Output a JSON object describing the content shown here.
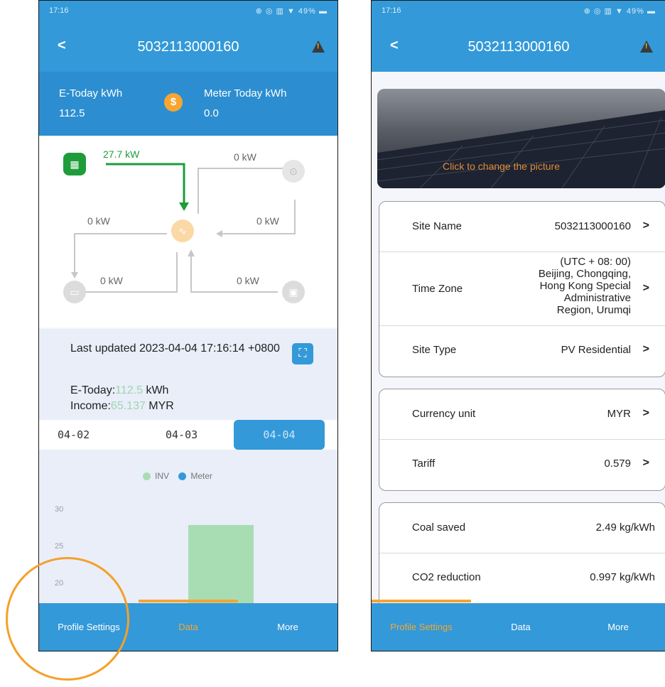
{
  "left": {
    "status_time": "17:16",
    "status_icons": "⊕ ◎ ▥ ▼ 49% ▬",
    "title": "5032113000160",
    "back": "<",
    "energy": {
      "e_today_label": "E-Today kWh",
      "e_today_value": "112.5",
      "meter_label": "Meter Today kWh",
      "meter_value": "0.0",
      "coin": "$"
    },
    "flow": {
      "pv_power": "27.7 kW",
      "grid_power_top": "0 kW",
      "left_power": "0 kW",
      "right_power": "0 kW",
      "battery_power": "0 kW",
      "load_power": "0 kW"
    },
    "card": {
      "updated": "Last updated 2023-04-04 17:16:14 +0800",
      "e_today_label": "E-Today:",
      "e_today_value": "112.5",
      "e_today_unit": " kWh",
      "income_label": "Income:",
      "income_value": "65.137",
      "income_unit": " MYR",
      "dates": [
        "04-02",
        "04-03",
        "04-04"
      ],
      "legend_inv": "INV",
      "legend_meter": "Meter",
      "yticks": [
        "30",
        "25",
        "20"
      ]
    },
    "tabs": [
      "Profile Settings",
      "Data",
      "More"
    ]
  },
  "right": {
    "status_time": "17:16",
    "status_icons": "⊕ ◎ ▥ ▼ 49% ▬",
    "title": "5032113000160",
    "back": "<",
    "hero_text": "Click to change the picture",
    "rows1": [
      {
        "label": "Site Name",
        "value": "5032113000160"
      },
      {
        "label": "Time Zone",
        "value": "(UTC + 08: 00) Beijing, Chongqing, Hong Kong Special Administrative Region, Urumqi"
      },
      {
        "label": "Site Type",
        "value": "PV Residential"
      }
    ],
    "tz_lines": [
      "(UTC + 08: 00)",
      "Beijing, Chongqing,",
      "Hong Kong Special",
      "Administrative",
      "Region, Urumqi"
    ],
    "rows2": [
      {
        "label": "Currency unit",
        "value": "MYR"
      },
      {
        "label": "Tariff",
        "value": "0.579"
      }
    ],
    "rows3": [
      {
        "label": "Coal saved",
        "value": "2.49 kg/kWh"
      },
      {
        "label": "CO2 reduction",
        "value": "0.997 kg/kWh"
      }
    ],
    "chevron": ">",
    "tabs": [
      "Profile Settings",
      "Data",
      "More"
    ]
  },
  "chart_data": {
    "type": "bar",
    "series": [
      {
        "name": "INV",
        "color": "#a8ddb3"
      },
      {
        "name": "Meter",
        "color": "#3399d8"
      }
    ],
    "ylim": [
      20,
      30
    ],
    "yticks": [
      30,
      25,
      20
    ]
  },
  "colors": {
    "primary": "#3399d8",
    "accent": "#f6a531",
    "pv_green": "#1f9c3a"
  }
}
